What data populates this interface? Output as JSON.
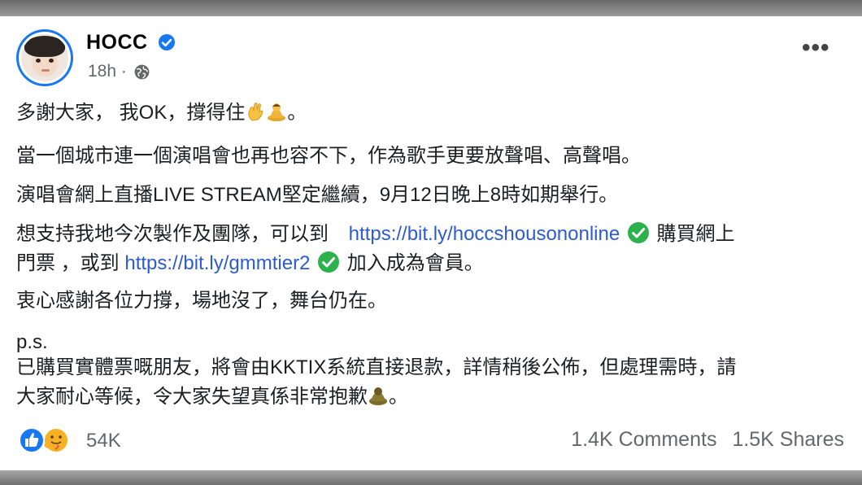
{
  "post": {
    "author": "HOCC",
    "time": "18h",
    "dot": "·",
    "more_label": "•••",
    "lines": {
      "l1": "多謝大家， 我OK，撐得住",
      "l1_end": "。",
      "l2": "當一個城市連一個演唱會也再也容不下，作為歌手更要放聲唱、高聲唱。",
      "l3": "演唱會網上直播LIVE STREAM堅定繼續，9月12日晚上8時如期舉行。",
      "l4_pre": "想支持我地今次製作及團隊，可以到 ",
      "l4_link": "https://bit.ly/hoccshousononline",
      "l4_post": " 購買網上",
      "l5_pre": "門票 ，或到 ",
      "l5_link": "https://bit.ly/gmmtier2",
      "l5_post": " 加入成為會員。",
      "l6": "衷心感謝各位力撐，場地沒了，舞台仍在。",
      "l7": "p.s.",
      "l8": "已購買實體票嘅朋友，將會由KKTIX系統直接退款，詳情稍後公佈，但處理需時，請",
      "l9": "大家耐心等候，令大家失望真係非常抱歉",
      "l9_end": "。"
    },
    "reactions_count": "54K",
    "comments": "1.4K Comments",
    "shares": "1.5K Shares"
  },
  "icons": {
    "verified": "verified-badge-icon",
    "privacy": "globe-icon",
    "ok_hand": "ok-hand-emoji",
    "pray": "folded-hands-emoji",
    "pray2": "bowing-emoji",
    "like": "like-reaction-icon",
    "care": "care-reaction-icon",
    "link_check": "green-check-icon"
  },
  "colors": {
    "link": "#2d5bd3",
    "verified": "#1877f2",
    "check": "#2bb24c",
    "meta": "#65676b"
  }
}
